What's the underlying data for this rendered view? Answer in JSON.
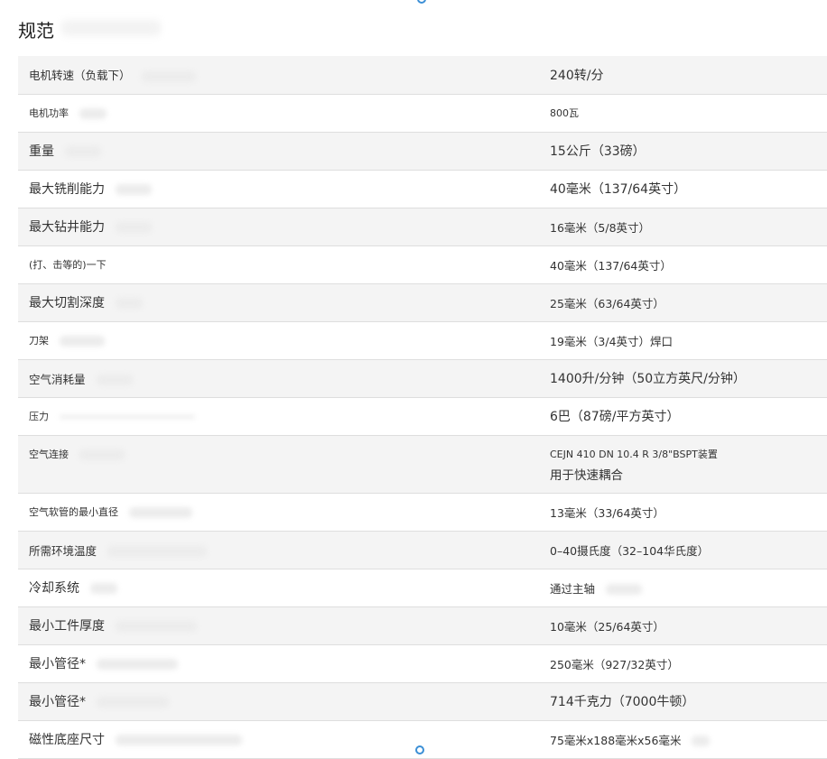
{
  "page": {
    "title": "规范"
  },
  "specs": [
    {
      "label": "电机转速（负载下）",
      "value": "240转/分"
    },
    {
      "label": "电机功率",
      "value": "800瓦"
    },
    {
      "label": "重量",
      "value": "15公斤（33磅）"
    },
    {
      "label": "最大铣削能力",
      "value": "40毫米（137/64英寸）"
    },
    {
      "label": "最大钻井能力",
      "value": "16毫米（5/8英寸）"
    },
    {
      "label": "(打、击等的)一下",
      "value": "40毫米（137/64英寸）"
    },
    {
      "label": "最大切割深度",
      "value": "25毫米（63/64英寸）"
    },
    {
      "label": "刀架",
      "value": "19毫米（3/4英寸）焊口"
    },
    {
      "label": "空气消耗量",
      "value": "1400升/分钟（50立方英尺/分钟）"
    },
    {
      "label": "压力",
      "value": "6巴（87磅/平方英寸）"
    },
    {
      "label": "空气连接",
      "value": "CEJN 410 DN 10.4 R 3/8\"BSPT装置",
      "value_line2": "用于快速耦合"
    },
    {
      "label": "空气软管的最小直径",
      "value": "13毫米（33/64英寸）"
    },
    {
      "label": "所需环境温度",
      "value": "0–40摄氏度（32–104华氏度）"
    },
    {
      "label": "冷却系统",
      "value": "通过主轴"
    },
    {
      "label": "最小工件厚度",
      "value": "10毫米（25/64英寸）"
    },
    {
      "label": "最小管径*",
      "value": "250毫米（927/32英寸）"
    },
    {
      "label": "最小管径*",
      "value": "714千克力（7000牛顿）"
    },
    {
      "label": "磁性底座尺寸",
      "value": "75毫米x188毫米x56毫米"
    }
  ]
}
